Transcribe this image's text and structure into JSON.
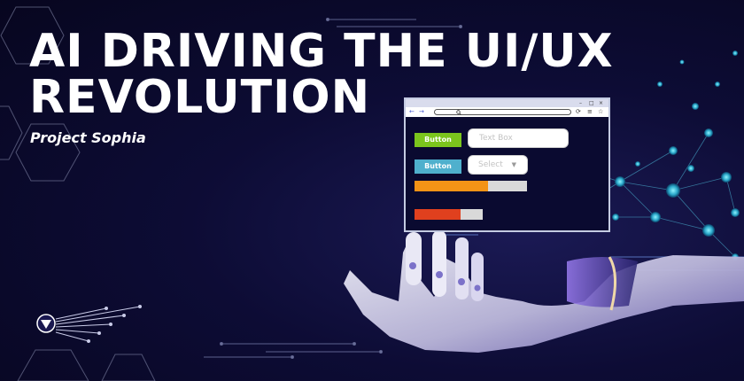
{
  "hero": {
    "title_line1": "AI DRIVING THE UI/UX",
    "title_line2": "REVOLUTION",
    "subtitle": "Project Sophia"
  },
  "mock_window": {
    "controls": [
      "–",
      "□",
      "×"
    ],
    "nav_back": "←",
    "nav_forward": "→",
    "search_icon": "search-icon",
    "button1_label": "Button",
    "button2_label": "Button",
    "textbox_placeholder": "Text Box",
    "select_value": "Select",
    "progress1_fraction": 0.65,
    "progress2_fraction": 0.68,
    "colors": {
      "button1": "#7bc51d",
      "button2": "#4fb0cd",
      "progress1": "#f39316",
      "progress2": "#e0401e"
    }
  },
  "icons": [
    "circuit-logo-icon",
    "robot-hand-icon",
    "network-node-icon",
    "hexagon-outline-icon"
  ]
}
